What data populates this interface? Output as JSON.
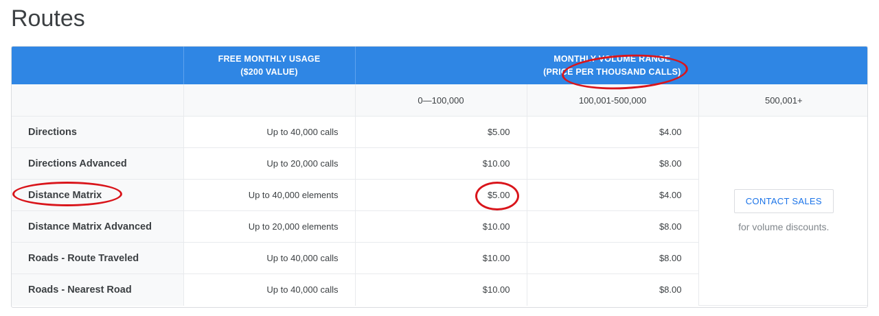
{
  "page": {
    "title": "Routes"
  },
  "table": {
    "header": {
      "free_line1": "FREE MONTHLY USAGE",
      "free_line2": "($200 VALUE)",
      "volume_line1": "MONTHLY VOLUME RANGE",
      "volume_line2": "(PRICE PER THOUSAND CALLS)"
    },
    "tiers": [
      "0—100,000",
      "100,001-500,000",
      "500,001+"
    ],
    "rows": [
      {
        "service": "Directions",
        "free": "Up to 40,000 calls",
        "tier1": "$5.00",
        "tier2": "$4.00"
      },
      {
        "service": "Directions Advanced",
        "free": "Up to 20,000 calls",
        "tier1": "$10.00",
        "tier2": "$8.00"
      },
      {
        "service": "Distance Matrix",
        "free": "Up to 40,000 elements",
        "tier1": "$5.00",
        "tier2": "$4.00"
      },
      {
        "service": "Distance Matrix Advanced",
        "free": "Up to 20,000 elements",
        "tier1": "$10.00",
        "tier2": "$8.00"
      },
      {
        "service": "Roads - Route Traveled",
        "free": "Up to 40,000 calls",
        "tier1": "$10.00",
        "tier2": "$8.00"
      },
      {
        "service": "Roads - Nearest Road",
        "free": "Up to 40,000 calls",
        "tier1": "$10.00",
        "tier2": "$8.00"
      }
    ],
    "contact": {
      "button_label": "CONTACT SALES",
      "note": "for volume discounts."
    }
  },
  "colors": {
    "header_bg": "#2f86e4",
    "annotation_red": "#d9151b",
    "link_blue": "#1a73e8"
  }
}
